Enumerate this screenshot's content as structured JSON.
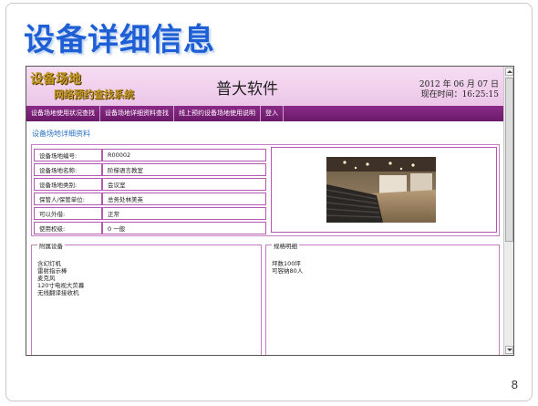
{
  "slide": {
    "title": "设备详细信息",
    "page_number": "8"
  },
  "app": {
    "logo_line1": "设备场地",
    "logo_line2": "网络预约查找系统",
    "company": "普大软件",
    "date_text": "2012 年 06 月 07 日",
    "time_text": "现在时间：16:25:15"
  },
  "nav": {
    "items": [
      {
        "label": "设备场地使用状况查找"
      },
      {
        "label": "设备场地详细资料查找"
      },
      {
        "label": "线上预约设备场地使用说明"
      },
      {
        "label": "登入"
      }
    ]
  },
  "detail": {
    "section_title": "设备场地详细资料",
    "rows": [
      {
        "label": "设备场地编号:",
        "value": "R00002"
      },
      {
        "label": "设备场地名称:",
        "value": "阶梯语言教室"
      },
      {
        "label": "设备场地类别:",
        "value": "会议室"
      },
      {
        "label": "保管人/保管单位:",
        "value": "总务处林美英"
      },
      {
        "label": "可以外借:",
        "value": "正常"
      },
      {
        "label": "使用权级:",
        "value": "0  一般"
      }
    ],
    "photo_icon": "lecture-hall-photo"
  },
  "equipment": {
    "legend": "附属设备",
    "items": [
      "含幻灯机",
      "雷射指示棒",
      "麦克风",
      "120寸电视大荧幕",
      "无线翻译接收机"
    ]
  },
  "spec": {
    "legend": "规格明细",
    "items": [
      "坪数100坪",
      "可容纳80人"
    ]
  }
}
